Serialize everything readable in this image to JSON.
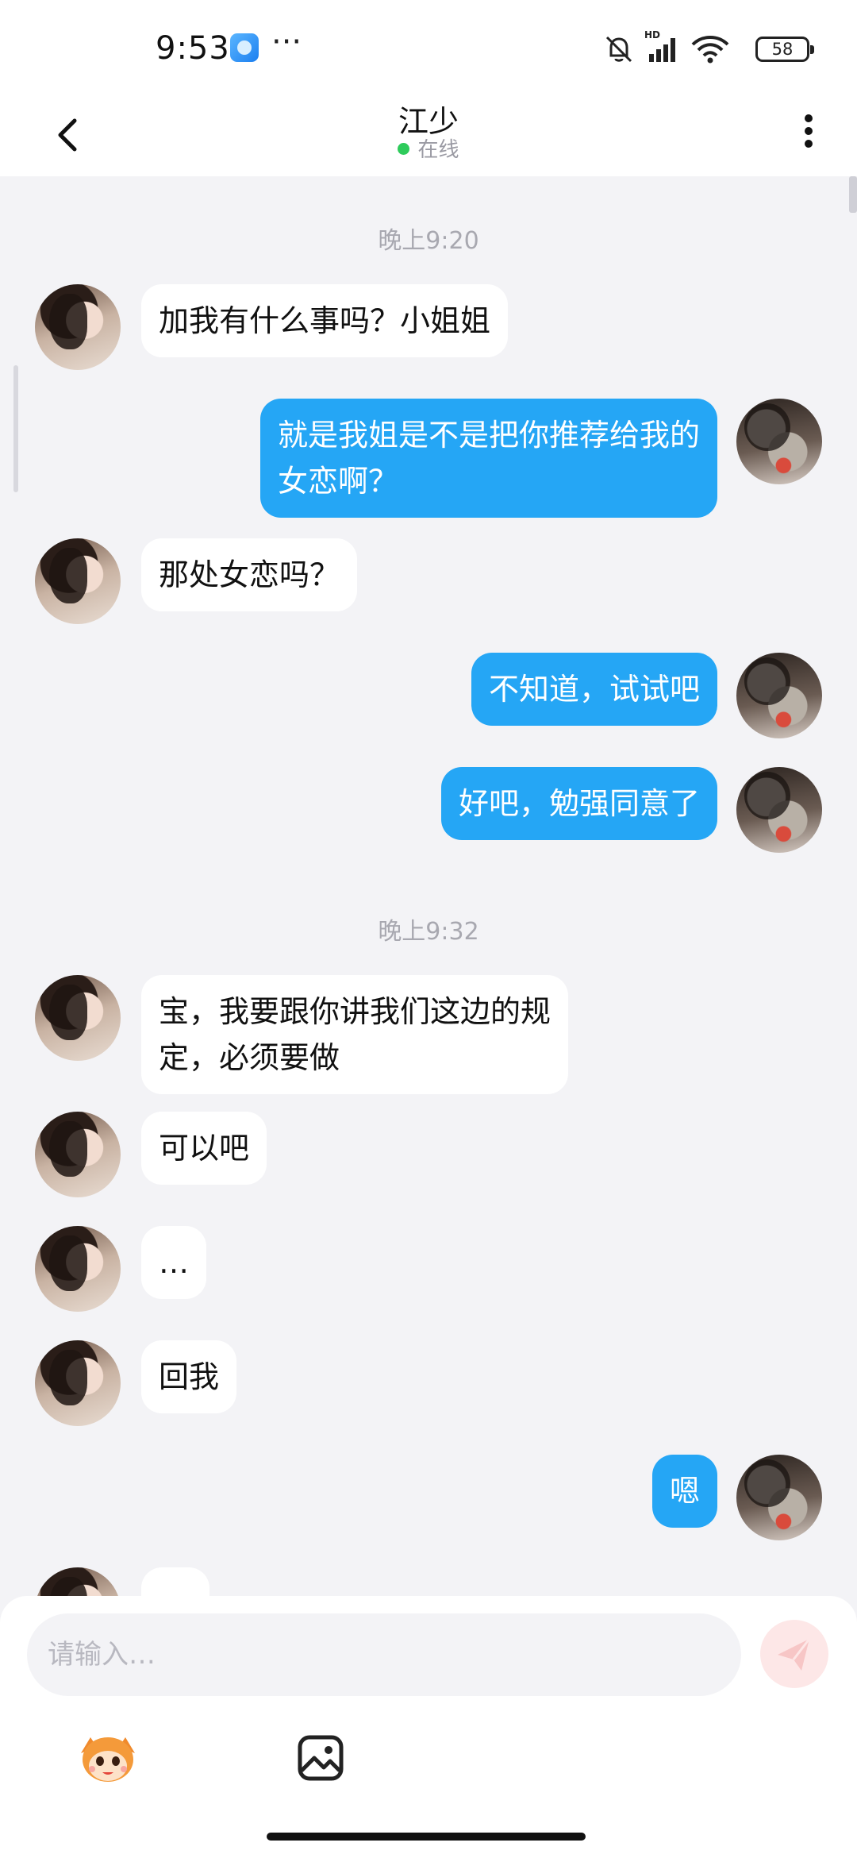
{
  "status_bar": {
    "time": "9:53",
    "more_indicator": "···",
    "battery_level": "58",
    "icons": [
      "app-notification-icon",
      "mute-bell-icon",
      "hd-signal-icon",
      "wifi-icon",
      "battery-icon"
    ]
  },
  "header": {
    "title": "江少",
    "status": "在线"
  },
  "messages": [
    {
      "type": "time",
      "text": "晚上9:20"
    },
    {
      "type": "msg",
      "from": "them",
      "text": "加我有什么事吗？小姐姐"
    },
    {
      "type": "msg",
      "from": "me",
      "text": "就是我姐是不是把你推荐给我的\n女恋啊？"
    },
    {
      "type": "msg",
      "from": "them",
      "text": "那处女恋吗？"
    },
    {
      "type": "msg",
      "from": "me",
      "text": "不知道，试试吧"
    },
    {
      "type": "msg",
      "from": "me",
      "text": "好吧，勉强同意了"
    },
    {
      "type": "time",
      "text": "晚上9:32"
    },
    {
      "type": "msg",
      "from": "them",
      "text": "宝，我要跟你讲我们这边的规\n定，必须要做"
    },
    {
      "type": "msg",
      "from": "them",
      "text": "可以吧"
    },
    {
      "type": "msg",
      "from": "them",
      "text": "…"
    },
    {
      "type": "msg",
      "from": "them",
      "text": "回我"
    },
    {
      "type": "msg",
      "from": "me",
      "text": "嗯"
    }
  ],
  "composer": {
    "placeholder": "请输入…"
  },
  "colors": {
    "my_bubble": "#25a6f5",
    "their_bubble": "#ffffff",
    "background": "#f3f3f6",
    "online": "#2ecb5b"
  }
}
